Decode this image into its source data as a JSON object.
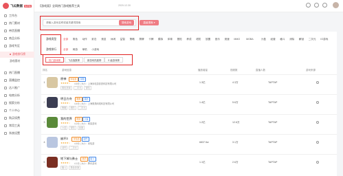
{
  "app": {
    "logo_text": "飞瓜数据",
    "logo_badge": "快手版"
  },
  "topbar": {
    "breadcrumb": "【游戏类】全网热门游戏推荐工具",
    "date": "2020-12-30"
  },
  "sidebar": {
    "items": [
      {
        "label": "工作台",
        "icon": "home-icon"
      },
      {
        "label": "热门素材",
        "icon": "fire-icon"
      },
      {
        "label": "带货直播",
        "icon": "live-icon"
      },
      {
        "label": "商品分析",
        "icon": "goods-icon"
      },
      {
        "label": "游戏专区",
        "icon": "game-icon"
      },
      {
        "label": "热门直播",
        "icon": "tv-icon"
      },
      {
        "label": "直播监控",
        "icon": "monitor-icon"
      },
      {
        "label": "达人推广",
        "icon": "promote-icon"
      },
      {
        "label": "电商分析",
        "icon": "shop-icon"
      },
      {
        "label": "搜索分析",
        "icon": "search-icon"
      },
      {
        "label": "个人中心",
        "icon": "user-icon"
      },
      {
        "label": "购买续费",
        "icon": "cart-icon"
      },
      {
        "label": "常用工具",
        "icon": "tool-icon"
      },
      {
        "label": "系统设置",
        "icon": "setting-icon"
      }
    ],
    "sub_items": [
      {
        "label": "游戏排行榜",
        "active": true
      },
      {
        "label": "游戏素材",
        "active": false
      }
    ]
  },
  "search": {
    "placeholder": "请输入游戏名称或者关键词搜索",
    "button": "搜索游戏",
    "advanced_button": "高级搜索 ▾"
  },
  "filters": {
    "category_label": "游戏类型",
    "categories": [
      "全部",
      "角色",
      "动作",
      "射击",
      "竞技",
      "休闲",
      "益智",
      "策略",
      "棋牌",
      "卡牌",
      "模拟",
      "体育",
      "冒险",
      "养成",
      "塔防",
      "放置",
      "音乐",
      "竞速",
      "MMO",
      "MOBA",
      "沙盒",
      "经营",
      "格斗",
      "消除",
      "解谜",
      "二次元",
      "IO游戏"
    ],
    "sub_row": [
      "全部",
      "网游",
      "单机",
      "小游戏"
    ],
    "rank_label": "游戏排行",
    "rank_tabs": [
      {
        "label": "热门游戏榜",
        "active": true
      },
      {
        "label": "飞瓜指数榜",
        "active": false
      },
      {
        "label": "新游戏热度榜",
        "active": false
      },
      {
        "label": "S 级游戏榜",
        "active": false
      }
    ]
  },
  "table": {
    "headers": [
      "排名",
      "游戏信息",
      "播放增量",
      "视频数",
      "直播人数",
      "游戏来源"
    ],
    "rows": [
      {
        "rank": "1",
        "name": "原神",
        "tags": [
          {
            "t": "米哈游",
            "c": "orange"
          },
          {
            "t": "冒险",
            "c": "blue"
          }
        ],
        "score": "9.0",
        "meta": "4.6分 | 大小：上海米哈游影铁科技有限公司",
        "sub": [
          "角色扮演",
          "二次元",
          "冒险"
        ],
        "play": "1.3亿",
        "videos": "4.3万",
        "source": "TAPTAP",
        "icon_color": "#d8c7a2"
      },
      {
        "rank": "2",
        "name": "明日方舟",
        "tags": [
          {
            "t": "鹰角",
            "c": "orange"
          },
          {
            "t": "塔防",
            "c": "blue"
          }
        ],
        "score": "8.8",
        "meta": "4.4分 | 大小：上海鹰角网络科技有限公司",
        "sub": [
          "策略",
          "塔防",
          "二次元"
        ],
        "play": "1.4亿",
        "videos": "5.6万",
        "source": "TAPTAP",
        "icon_color": "#3b3d52"
      },
      {
        "rank": "3",
        "name": "我的世界",
        "tags": [
          {
            "t": "网易",
            "c": "orange"
          },
          {
            "t": "沙盒",
            "c": "blue"
          }
        ],
        "score": "8.5",
        "meta": "4.2分 | 大小：网易游戏",
        "sub": [
          "沙盒",
          "冒险",
          "创造"
        ],
        "play": "1.2亿",
        "videos": "12.6万",
        "source": "TAPTAP",
        "icon_color": "#5a8a3a"
      },
      {
        "rank": "4",
        "name": "崩坏3",
        "tags": [
          {
            "t": "米哈游",
            "c": "orange"
          },
          {
            "t": "动作",
            "c": "blue"
          }
        ],
        "score": "8.6",
        "meta": "4.5分 | 大小：米哈游",
        "sub": [
          "动作",
          "二次元"
        ],
        "play": "6837.5w",
        "videos": "3.1万",
        "source": "TAPTAP",
        "icon_color": "#b9c6e0"
      },
      {
        "rank": "5",
        "name": "地下城与勇士",
        "tags": [
          {
            "t": "腾讯",
            "c": "orange"
          },
          {
            "t": "格斗",
            "c": "blue"
          }
        ],
        "score": "8.2",
        "meta": "4.1分 | 大小：腾讯游戏",
        "sub": [
          "格斗",
          "角色扮演"
        ],
        "play": "1.1亿",
        "videos": "2.6万",
        "source": "TAPTAP",
        "icon_color": "#7a2e22"
      }
    ]
  },
  "colors": {
    "accent": "#e8545b",
    "button": "#ef7c84",
    "highlight_box": "#e02020"
  }
}
